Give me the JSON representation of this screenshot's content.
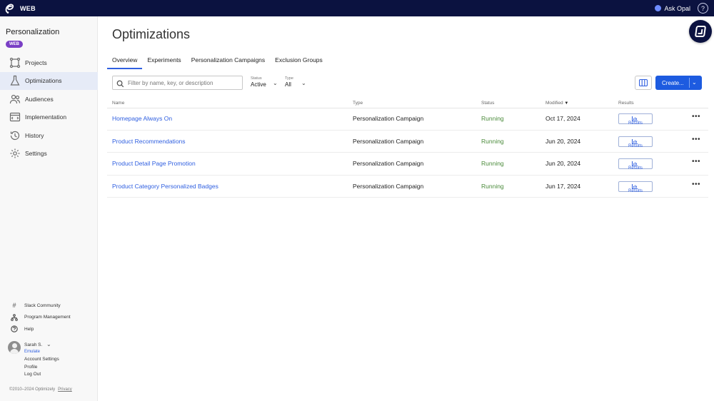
{
  "topbar": {
    "product": "WEB",
    "ask_opal": "Ask Opal",
    "help_glyph": "?"
  },
  "sidebar": {
    "title": "Personalization",
    "badge": "WEB",
    "items": [
      {
        "label": "Projects",
        "icon": "projects-icon"
      },
      {
        "label": "Optimizations",
        "icon": "flask-icon",
        "active": true
      },
      {
        "label": "Audiences",
        "icon": "users-icon"
      },
      {
        "label": "Implementation",
        "icon": "code-window-icon"
      },
      {
        "label": "History",
        "icon": "history-icon"
      },
      {
        "label": "Settings",
        "icon": "gear-icon"
      }
    ],
    "links": [
      {
        "label": "Slack Community",
        "icon": "hash-icon"
      },
      {
        "label": "Program Management",
        "icon": "org-chart-icon"
      },
      {
        "label": "Help",
        "icon": "help-icon"
      }
    ],
    "user": {
      "name": "Sarah S.",
      "emulate": "Emulate",
      "account_settings": "Account Settings",
      "profile": "Profile",
      "logout": "Log Out"
    },
    "footer": {
      "copyright": "©2010–2024 Optimizely",
      "privacy": "Privacy"
    }
  },
  "main": {
    "title": "Optimizations",
    "tabs": [
      {
        "label": "Overview",
        "active": true
      },
      {
        "label": "Experiments"
      },
      {
        "label": "Personalization Campaigns"
      },
      {
        "label": "Exclusion Groups"
      }
    ],
    "filter": {
      "placeholder": "Filter by name, key, or description",
      "value": ""
    },
    "status_dropdown": {
      "label": "Status",
      "value": "Active"
    },
    "type_dropdown": {
      "label": "Type",
      "value": "All"
    },
    "create_label": "Create...",
    "table": {
      "headers": {
        "name": "Name",
        "type": "Type",
        "status": "Status",
        "modified": "Modified",
        "results": "Results"
      },
      "results_label": "Results",
      "rows": [
        {
          "name": "Homepage Always On",
          "type": "Personalization Campaign",
          "status": "Running",
          "modified": "Oct 17, 2024"
        },
        {
          "name": "Product Recommendations",
          "type": "Personalization Campaign",
          "status": "Running",
          "modified": "Jun 20, 2024"
        },
        {
          "name": "Product Detail Page Promotion",
          "type": "Personalization Campaign",
          "status": "Running",
          "modified": "Jun 20, 2024"
        },
        {
          "name": "Product Category Personalized Badges",
          "type": "Personalization Campaign",
          "status": "Running",
          "modified": "Jun 17, 2024"
        }
      ]
    }
  },
  "colors": {
    "topbar_bg": "#0b1240",
    "accent": "#2f5fe0",
    "primary_button": "#1d5be0",
    "badge": "#7a3fc5",
    "status_running": "#4b8b3b"
  }
}
